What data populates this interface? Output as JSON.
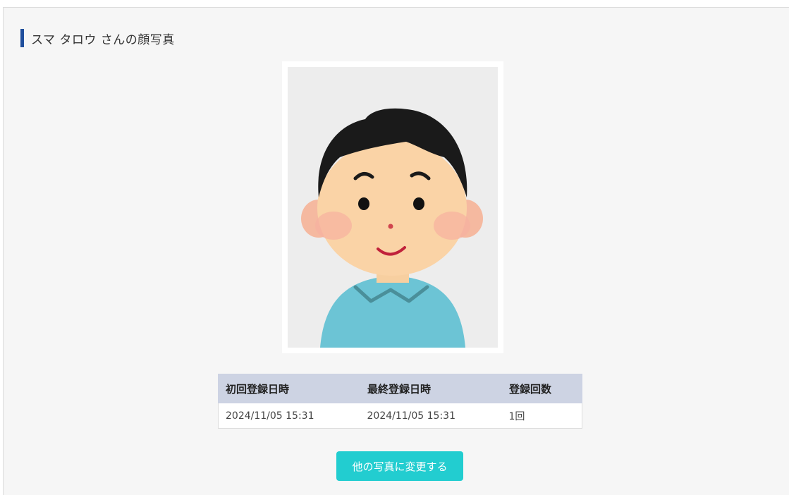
{
  "page": {
    "title": "スマ タロウ さんの顔写真"
  },
  "photo": {
    "subject": "face-photo-illustration"
  },
  "registration_table": {
    "headers": [
      "初回登録日時",
      "最終登録日時",
      "登録回数"
    ],
    "rows": [
      [
        "2024/11/05 15:31",
        "2024/11/05 15:31",
        "1回"
      ]
    ]
  },
  "actions": {
    "change_photo_label": "他の写真に変更する"
  },
  "colors": {
    "accent_bar": "#1f4e9c",
    "button": "#22cdd0",
    "table_header": "#cdd3e3"
  }
}
